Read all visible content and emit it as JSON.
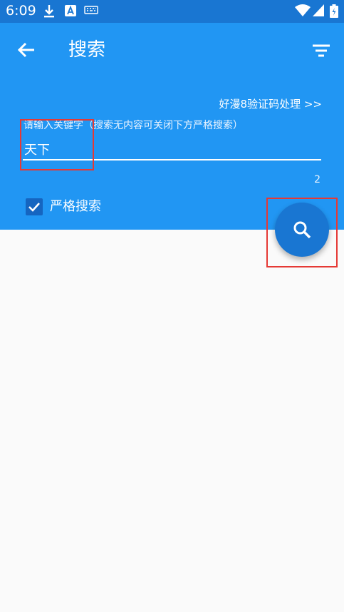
{
  "status_bar": {
    "time": "6:09",
    "icons": [
      "download-icon",
      "a-icon",
      "keyboard-icon",
      "wifi-icon",
      "signal-icon",
      "battery-icon"
    ]
  },
  "app_bar": {
    "title": "搜索",
    "back_icon": "arrow-left-icon",
    "filter_icon": "filter-icon"
  },
  "search": {
    "captcha_link": "好漫8验证码处理 >>",
    "label": "请输入关键字（搜索无内容可关闭下方严格搜索）",
    "value": "天下",
    "char_count": "2",
    "strict_search_label": "严格搜索",
    "strict_search_checked": true
  },
  "fab": {
    "icon": "search-icon"
  },
  "colors": {
    "status_bar": "#1976d2",
    "app_bar": "#2196f3",
    "fab": "#1976d2",
    "background": "#fafafa",
    "highlight": "#e53935"
  }
}
